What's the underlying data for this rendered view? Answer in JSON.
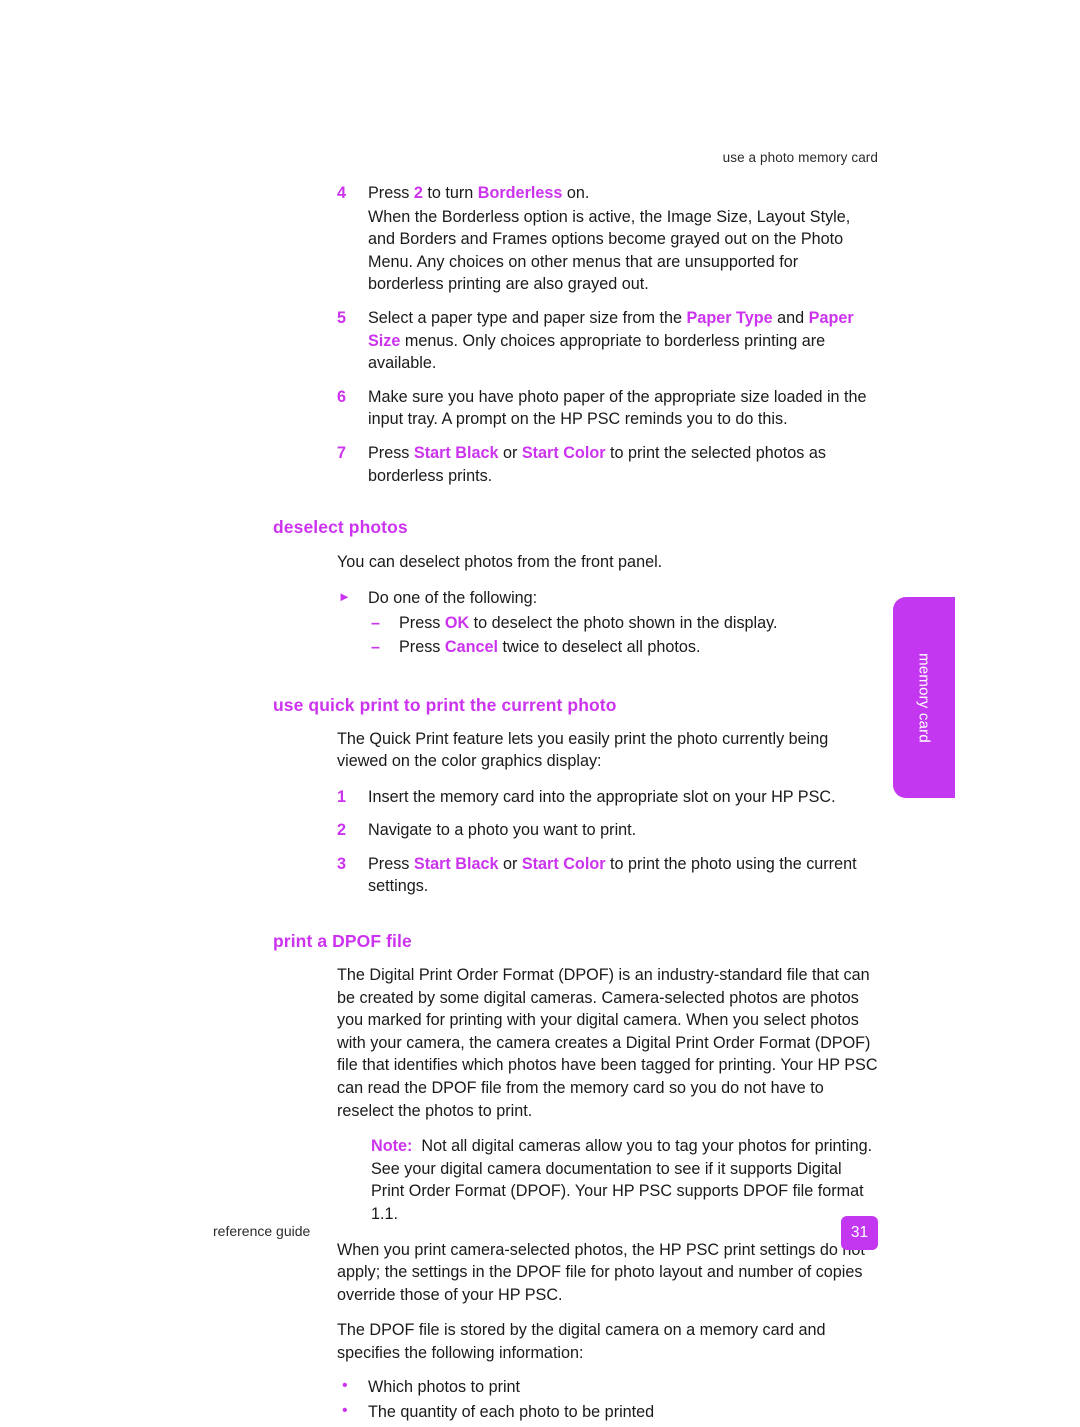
{
  "document": {
    "running_header": "use a photo memory card",
    "footer_label": "reference guide",
    "page_number": "31",
    "side_tab_label": "memory card",
    "accent_color": "#cc33ee",
    "tab_color": "#c337f0"
  },
  "borderless_steps": {
    "step4": {
      "number": "4",
      "lead_a": "Press ",
      "key_2": "2",
      "lead_b": " to turn ",
      "key_borderless": "Borderless",
      "lead_c": " on.",
      "continuation": "When the Borderless option is active, the Image Size, Layout Style, and Borders and Frames options become grayed out on the Photo Menu. Any choices on other menus that are unsupported for borderless printing are also grayed out."
    },
    "step5": {
      "number": "5",
      "part_a": "Select a paper type and paper size from the ",
      "key_paper_type": "Paper Type",
      "part_b": " and ",
      "key_paper_size": "Paper Size",
      "part_c": " menus. Only choices appropriate to borderless printing are available."
    },
    "step6": {
      "number": "6",
      "text": "Make sure you have photo paper of the appropriate size loaded in the input tray. A prompt on the HP PSC reminds you to do this."
    },
    "step7": {
      "number": "7",
      "part_a": "Press ",
      "key_start_black": "Start Black",
      "part_b": " or ",
      "key_start_color": "Start Color",
      "part_c": " to print the selected photos as borderless prints."
    }
  },
  "deselect_photos": {
    "heading": "deselect photos",
    "intro": "You can deselect photos from the front panel.",
    "arrow_marker": "triangle-right-bullet",
    "arrow_text": "Do one of the following:",
    "sub_items": [
      {
        "marker": "en-dash-bullet",
        "part_a": "Press ",
        "key": "OK",
        "part_b": " to deselect the photo shown in the display."
      },
      {
        "marker": "en-dash-bullet",
        "part_a": "Press ",
        "key": "Cancel",
        "part_b": " twice to deselect all photos."
      }
    ]
  },
  "quick_print": {
    "heading": "use quick print to print the current photo",
    "intro": "The Quick Print feature lets you easily print the photo currently being viewed on the color graphics display:",
    "steps": [
      {
        "number": "1",
        "text": "Insert the memory card into the appropriate slot on your HP PSC."
      },
      {
        "number": "2",
        "text": "Navigate to a photo you want to print."
      },
      {
        "number": "3",
        "part_a": "Press ",
        "key_start_black": "Start Black",
        "part_b": " or ",
        "key_start_color": "Start Color",
        "part_c": " to print the photo using the current settings."
      }
    ]
  },
  "dpof": {
    "heading": "print a DPOF file",
    "para1": "The Digital Print Order Format (DPOF) is an industry-standard file that can be created by some digital cameras. Camera-selected photos are photos you marked for printing with your digital camera. When you select photos with your camera, the camera creates a Digital Print Order Format (DPOF) file that identifies which photos have been tagged for printing. Your HP PSC can read the DPOF file from the memory card so you do not have to reselect the photos to print.",
    "note_label": "Note:",
    "note_text": "Not all digital cameras allow you to tag your photos for printing. See your digital camera documentation to see if it supports Digital Print Order Format (DPOF). Your HP PSC supports DPOF file format 1.1.",
    "para2": "When you print camera-selected photos, the HP PSC print settings do not apply; the settings in the DPOF file for photo layout and number of copies override those of your HP PSC.",
    "para3": "The DPOF file is stored by the digital camera on a memory card and specifies the following information:",
    "bullets": [
      "Which photos to print",
      "The quantity of each photo to be printed"
    ]
  }
}
